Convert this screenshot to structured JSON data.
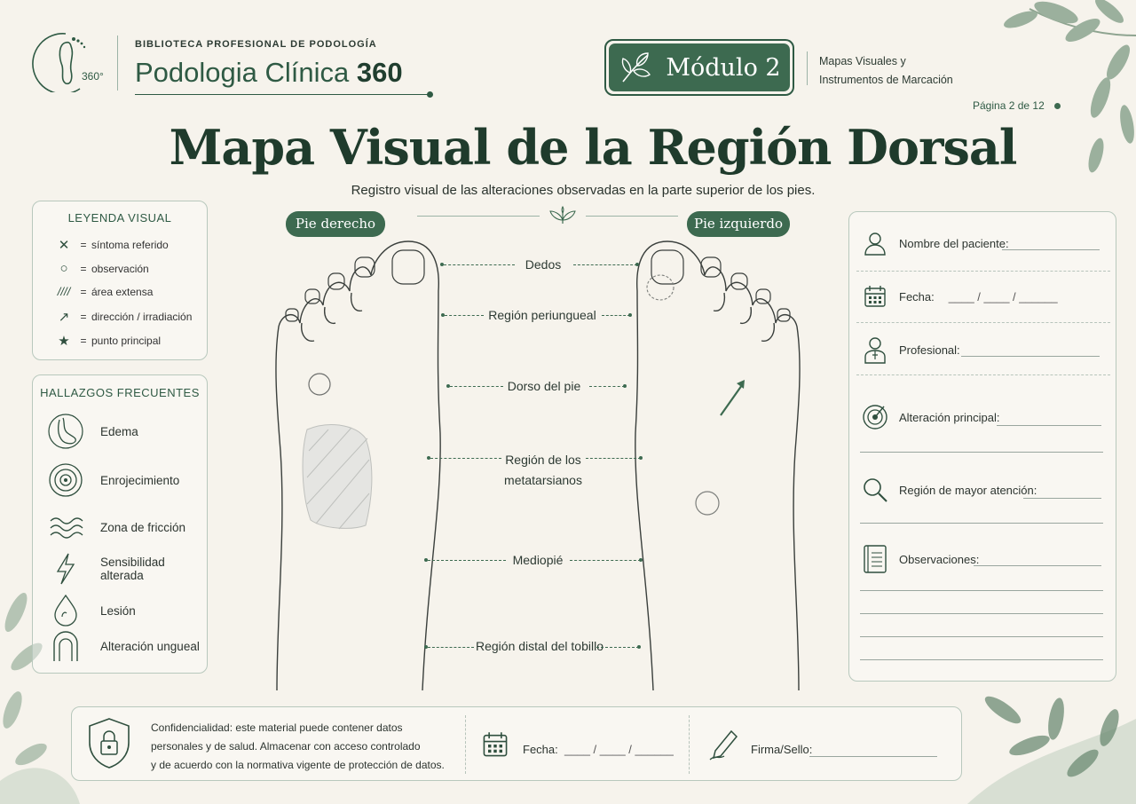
{
  "header": {
    "library_name": "BIBLIOTECA PROFESIONAL DE PODOLOGÍA",
    "app_title_main": "Podologia Clínica ",
    "app_title_bold": "360",
    "logo_text": "360°",
    "module_label": "Módulo 2",
    "module_subtitle_line1": "Mapas Visuales y",
    "module_subtitle_line2": "Instrumentos de Marcación",
    "page_indicator": "Página 2  de 12"
  },
  "title": "Mapa Visual de la Región Dorsal",
  "subtitle": "Registro visual de las alteraciones observadas en la parte superior de los pies.",
  "legend": {
    "title": "LEYENDA VISUAL",
    "eq": "=",
    "items": [
      {
        "symbol": "✕",
        "label": "síntoma referido"
      },
      {
        "symbol": "○",
        "label": "observación"
      },
      {
        "symbol": "////",
        "label": "área extensa"
      },
      {
        "symbol": "↗",
        "label": "dirección / irradiación"
      },
      {
        "symbol": "★",
        "label": "punto principal"
      }
    ]
  },
  "findings": {
    "title": "HALLAZGOS FRECUENTES",
    "items": [
      {
        "icon": "edema-foot-icon",
        "label": "Edema"
      },
      {
        "icon": "concentric-circles-icon",
        "label": "Enrojecimiento"
      },
      {
        "icon": "waves-icon",
        "label": "Zona de fricción"
      },
      {
        "icon": "lightning-icon",
        "label": "Sensibilidad alterada"
      },
      {
        "icon": "drop-icon",
        "label": "Lesión"
      },
      {
        "icon": "nail-icon",
        "label": "Alteración ungueal"
      }
    ]
  },
  "feet": {
    "right_label": "Pie derecho",
    "left_label": "Pie izquierdo",
    "regions": [
      "Dedos",
      "Región periungueal",
      "Dorso del pie",
      "Región de los",
      "metatarsianos",
      "Mediopié",
      "Región distal del tobillo"
    ]
  },
  "form": {
    "patient_name": "Nombre del paciente:",
    "date": "Fecha:",
    "date_placeholder": "____ / ____ / ______",
    "professional": "Profesional:",
    "main_alteration": "Alteración principal:",
    "attention_region": "Región de mayor atención:",
    "observations": "Observaciones:"
  },
  "footer": {
    "confidentiality_line1": "Confidencialidad: este material puede contener datos",
    "confidentiality_line2": "personales y de salud. Almacenar con acceso controlado",
    "confidentiality_line3": "y de acuerdo con la normativa vigente de protección de datos.",
    "date_label": "Fecha:",
    "date_placeholder": "____ / ____ / ______",
    "signature_label": "Firma/Sello:"
  },
  "colors": {
    "accent": "#3d6a50",
    "dark_green": "#1f3b2c",
    "background": "#f6f3ec"
  }
}
